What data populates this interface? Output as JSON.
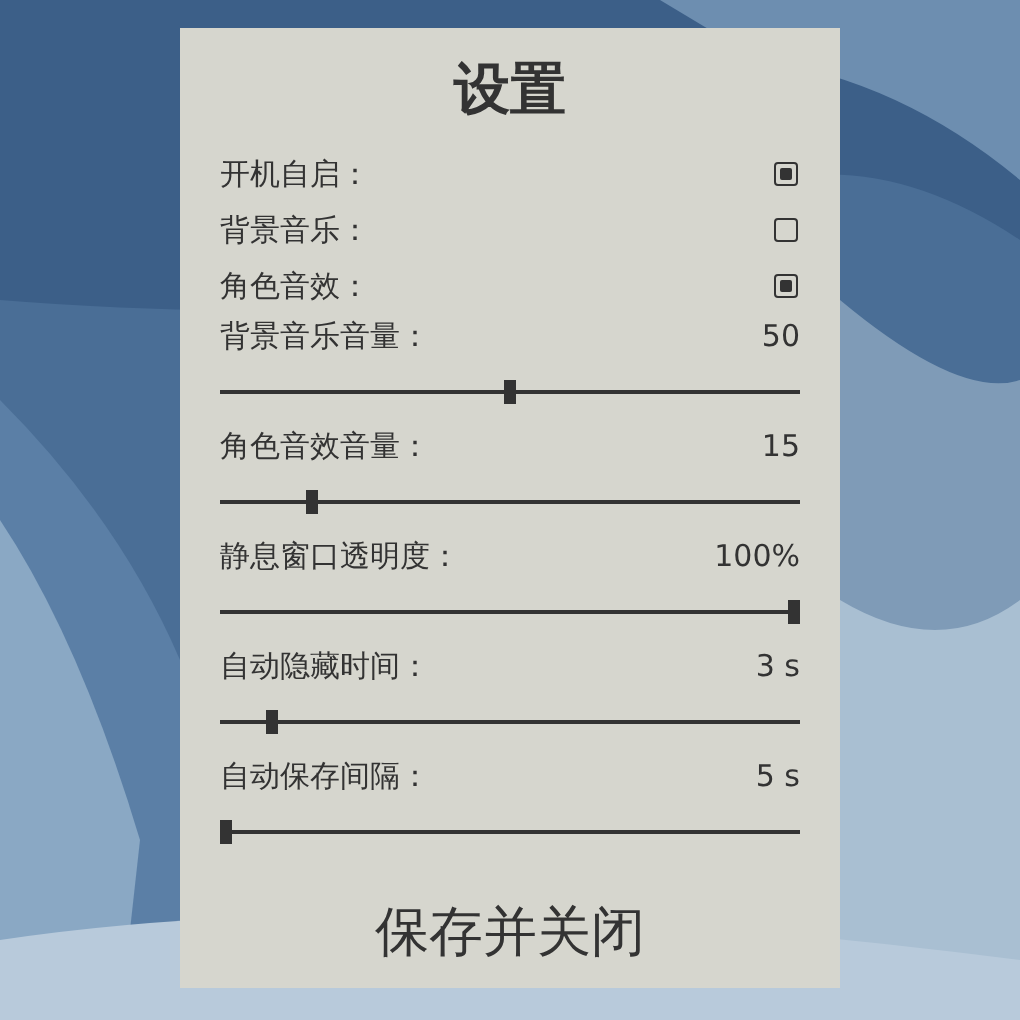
{
  "window": {
    "title": "设置"
  },
  "toggles": [
    {
      "label": "开机自启：",
      "checked": true
    },
    {
      "label": "背景音乐：",
      "checked": false
    },
    {
      "label": "角色音效：",
      "checked": true
    }
  ],
  "sliders": [
    {
      "label": "背景音乐音量：",
      "reading": "50",
      "level": 0.5
    },
    {
      "label": "角色音效音量：",
      "reading": "15",
      "level": 0.15
    },
    {
      "label": "静息窗口透明度：",
      "reading": "100%",
      "level": 1
    },
    {
      "label": "自动隐藏时间：",
      "reading": "3 s",
      "level": 0.08
    },
    {
      "label": "自动保存间隔：",
      "reading": "5 s",
      "level": 0
    }
  ],
  "buttons": [
    "保存并关闭"
  ]
}
